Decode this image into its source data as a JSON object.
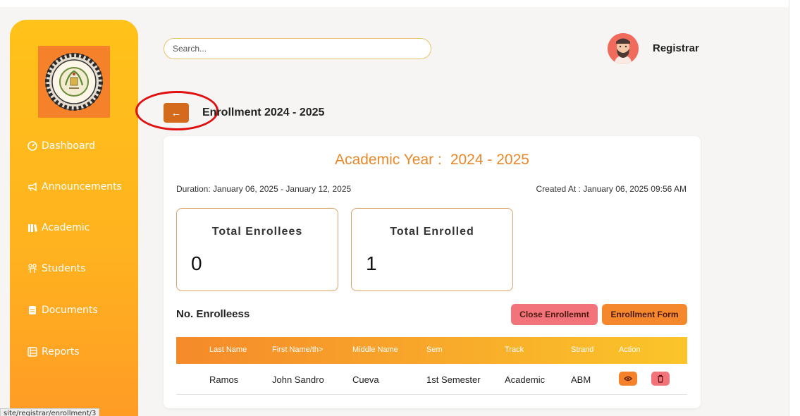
{
  "sidebar": {
    "logo_label": "school-seal-logo",
    "items": [
      {
        "label": "Dashboard",
        "icon": "dashboard-icon"
      },
      {
        "label": "Announcements",
        "icon": "megaphone-icon"
      },
      {
        "label": "Academic",
        "icon": "books-icon"
      },
      {
        "label": "Students",
        "icon": "students-icon"
      },
      {
        "label": "Documents",
        "icon": "document-icon"
      },
      {
        "label": "Reports",
        "icon": "reports-icon"
      }
    ]
  },
  "header": {
    "search_placeholder": "Search...",
    "user_name": "Registrar"
  },
  "page": {
    "back_icon": "←",
    "title": "Enrollment 2024 - 2025"
  },
  "card": {
    "academic_year_label": "Academic Year :",
    "academic_year_value": "2024 - 2025",
    "duration": "Duration: January 06, 2025 - January 12, 2025",
    "created_at": "Created At : January 06, 2025 09:56 AM",
    "stats": [
      {
        "label": "Total Enrollees",
        "value": "0"
      },
      {
        "label": "Total Enrolled",
        "value": "1"
      }
    ],
    "section_title": "No. Enrolleess",
    "close_button": "Close Enrollemnt",
    "form_button": "Enrollment Form"
  },
  "table": {
    "columns": [
      "Last Name",
      "First Name/th>",
      "Middle Name",
      "Sem",
      "Track",
      "Strand",
      "Action"
    ],
    "rows": [
      {
        "last_name": "Ramos",
        "first_name": "John Sandro",
        "middle_name": "Cueva",
        "sem": "1st Semester",
        "track": "Academic",
        "strand": "ABM"
      }
    ]
  },
  "status_url": "site/registrar/enrollment/3",
  "colors": {
    "sidebar_top": "#ffc21a",
    "sidebar_bottom": "#ff9a26",
    "accent_orange": "#f5822a",
    "title_orange": "#e8882a",
    "danger_pink": "#f3737a",
    "highlight_red": "#e01010"
  }
}
